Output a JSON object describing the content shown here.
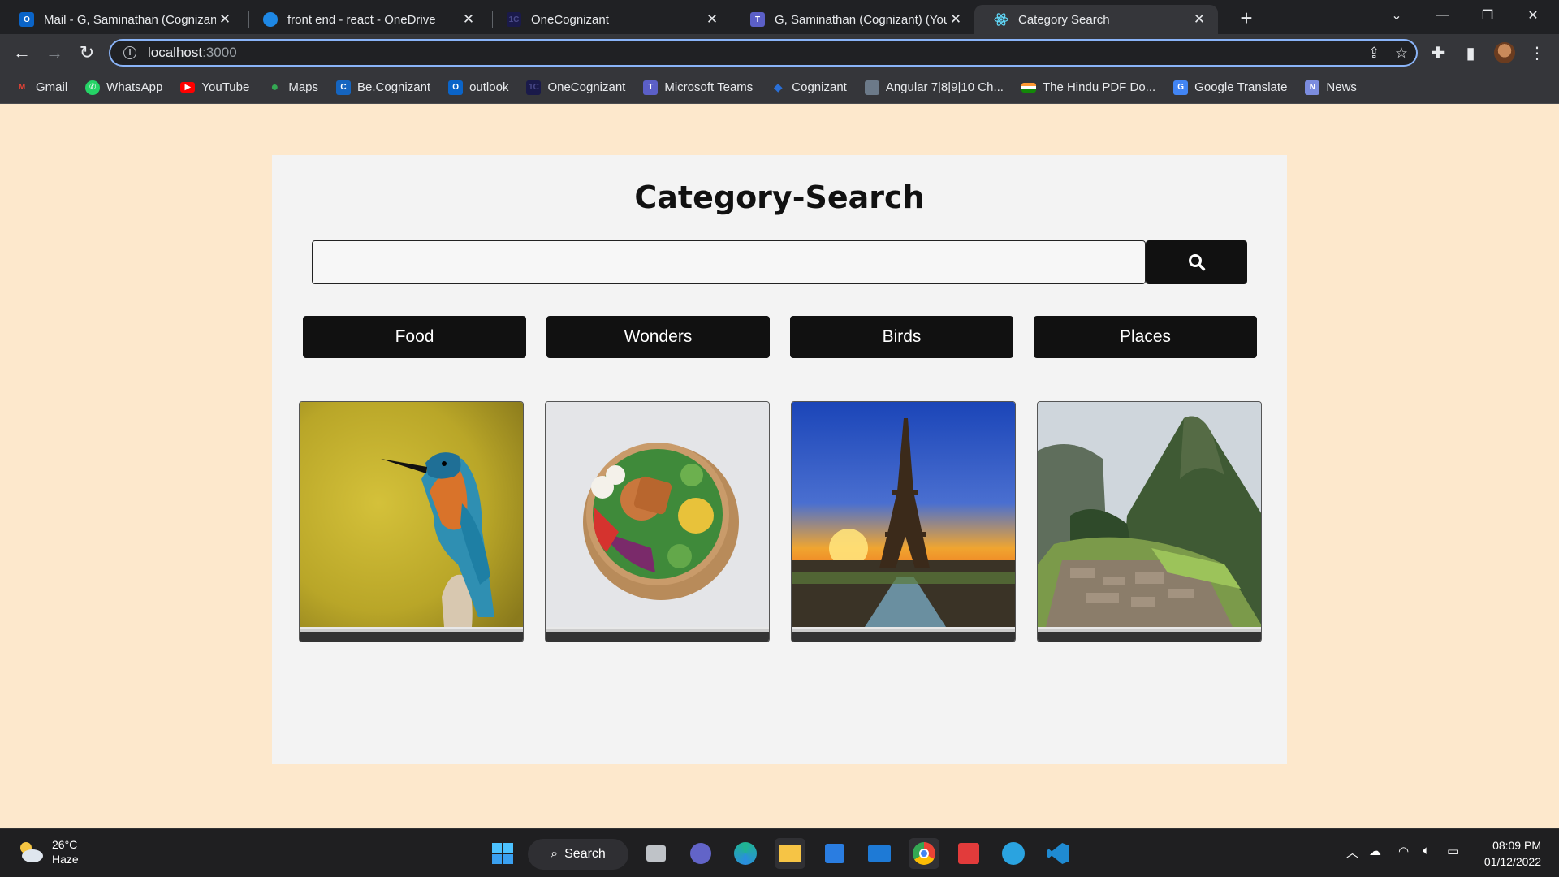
{
  "browser": {
    "tabs": [
      {
        "title": "Mail - G, Saminathan (Cognizant)",
        "icon": "outlook-icon",
        "color": "#0a64c8"
      },
      {
        "title": "front end - react - OneDrive",
        "icon": "onedrive-icon",
        "color": "#1e88e5"
      },
      {
        "title": "OneCognizant",
        "icon": "onecognizant-icon",
        "color": "#1a1a4a"
      },
      {
        "title": "G, Saminathan (Cognizant) (You)",
        "icon": "teams-icon",
        "color": "#5b5fc7"
      },
      {
        "title": "Category Search",
        "icon": "react-icon",
        "color": "#61dafb"
      }
    ],
    "url_host": "localhost",
    "url_port": ":3000",
    "bookmarks": [
      {
        "label": "Gmail",
        "icon": "gmail-icon",
        "color": "#ea4335"
      },
      {
        "label": "WhatsApp",
        "icon": "whatsapp-icon",
        "color": "#25d366"
      },
      {
        "label": "YouTube",
        "icon": "youtube-icon",
        "color": "#ff0000"
      },
      {
        "label": "Maps",
        "icon": "maps-icon",
        "color": "#34a853"
      },
      {
        "label": "Be.Cognizant",
        "icon": "becognizant-icon",
        "color": "#1565c0"
      },
      {
        "label": "outlook",
        "icon": "outlook-icon",
        "color": "#0a64c8"
      },
      {
        "label": "OneCognizant",
        "icon": "onecognizant-icon",
        "color": "#1a1a4a"
      },
      {
        "label": "Microsoft Teams",
        "icon": "teams-icon",
        "color": "#5b5fc7"
      },
      {
        "label": "Cognizant",
        "icon": "cognizant-icon",
        "color": "#2a6fd6"
      },
      {
        "label": "Angular 7|8|9|10 Ch...",
        "icon": "angular-icon",
        "color": "#6c7a89"
      },
      {
        "label": "The Hindu PDF Do...",
        "icon": "india-flag-icon",
        "color": "#ff9933"
      },
      {
        "label": "Google Translate",
        "icon": "translate-icon",
        "color": "#4285f4"
      },
      {
        "label": "News",
        "icon": "news-icon",
        "color": "#7b8cde"
      }
    ]
  },
  "page": {
    "title": "Category-Search",
    "search_placeholder": "",
    "categories": [
      "Food",
      "Wonders",
      "Birds",
      "Places"
    ],
    "images": [
      "Kingfisher bird",
      "Salad bowl",
      "Eiffel Tower",
      "Machu Picchu"
    ]
  },
  "taskbar": {
    "temperature": "26°C",
    "condition": "Haze",
    "search_label": "Search",
    "time": "08:09 PM",
    "date": "01/12/2022"
  }
}
